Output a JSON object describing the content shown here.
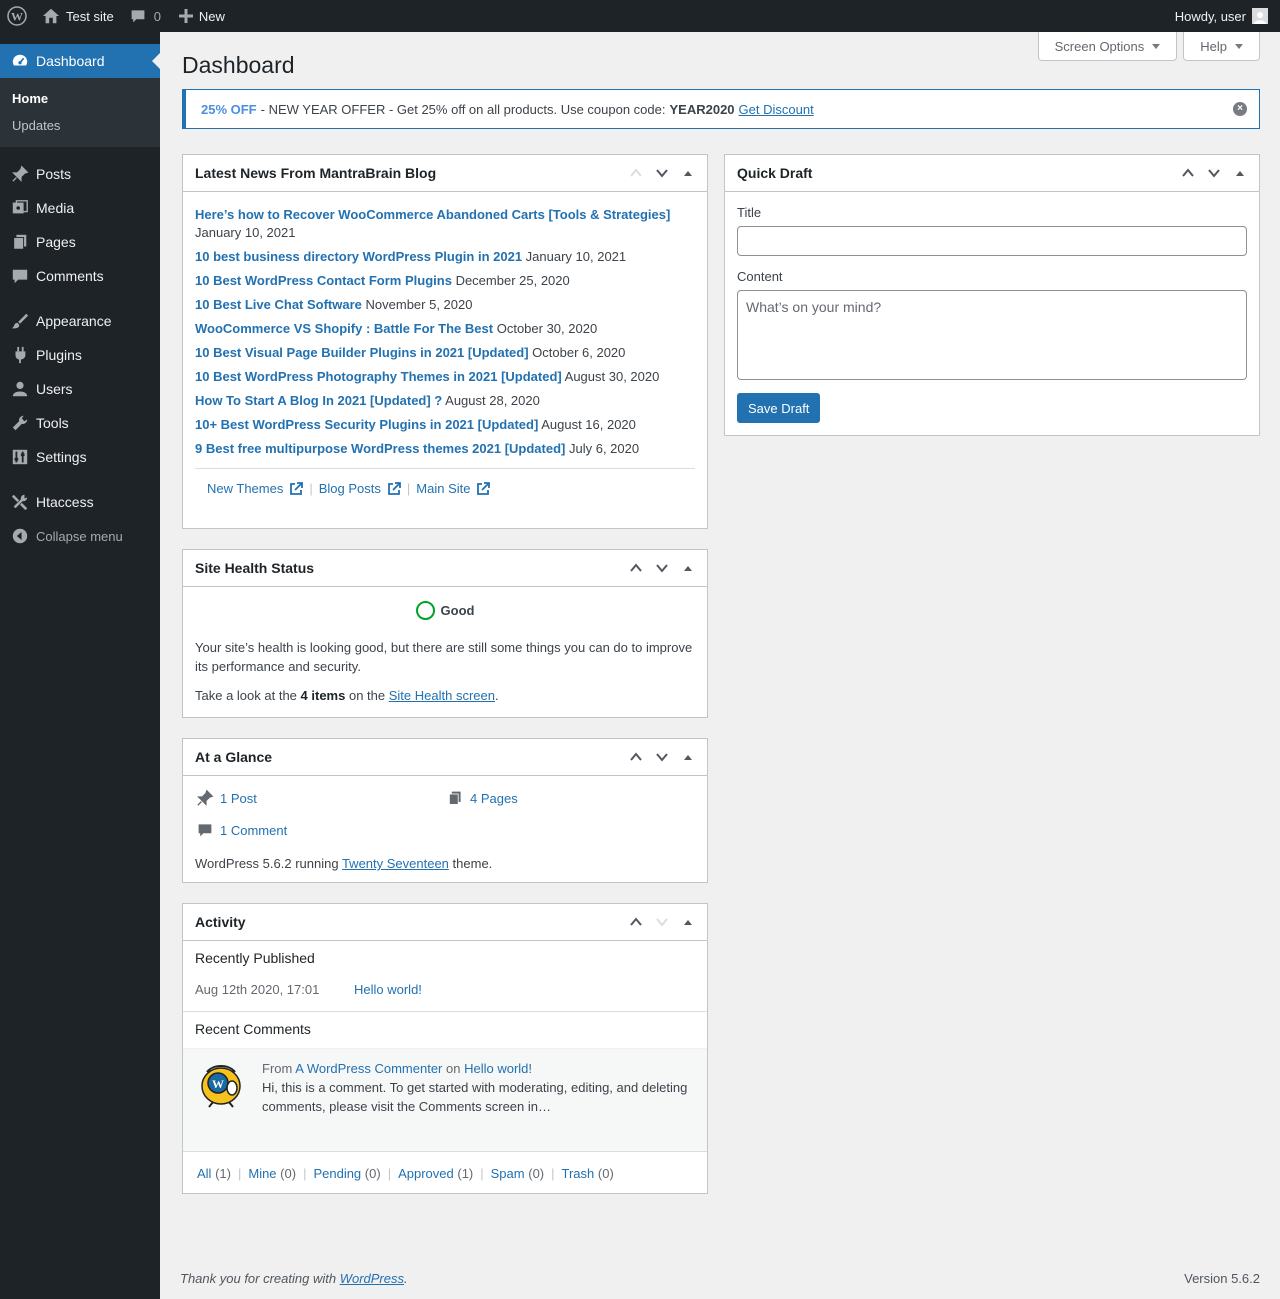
{
  "adminbar": {
    "site_name": "Test site",
    "comment_count": "0",
    "new_label": "New",
    "howdy": "Howdy, user"
  },
  "sidebar": {
    "current": "Dashboard",
    "submenu": [
      "Home",
      "Updates"
    ],
    "items": [
      {
        "label": "Posts",
        "icon": "pin-icon"
      },
      {
        "label": "Media",
        "icon": "media-icon"
      },
      {
        "label": "Pages",
        "icon": "pages-icon"
      },
      {
        "label": "Comments",
        "icon": "comments-icon"
      },
      {
        "label": "Appearance",
        "icon": "brush-icon"
      },
      {
        "label": "Plugins",
        "icon": "plugin-icon"
      },
      {
        "label": "Users",
        "icon": "user-icon"
      },
      {
        "label": "Tools",
        "icon": "wrench-icon"
      },
      {
        "label": "Settings",
        "icon": "settings-icon"
      },
      {
        "label": "Htaccess",
        "icon": "tools-icon"
      }
    ],
    "collapse": "Collapse menu"
  },
  "screen_meta": {
    "screen_options": "Screen Options",
    "help": "Help"
  },
  "page_title": "Dashboard",
  "notice": {
    "badge": "25% OFF",
    "text": "- NEW YEAR OFFER - Get 25% off on all products. Use coupon code:",
    "code": "YEAR2020",
    "link": "Get Discount"
  },
  "news": {
    "title": "Latest News From MantraBrain Blog",
    "items": [
      {
        "title": "Here’s how to Recover WooCommerce Abandoned Carts [Tools & Strategies]",
        "date": "January 10, 2021"
      },
      {
        "title": "10 best business directory WordPress Plugin in 2021",
        "date": "January 10, 2021"
      },
      {
        "title": "10 Best WordPress Contact Form Plugins",
        "date": "December 25, 2020"
      },
      {
        "title": "10 Best Live Chat Software",
        "date": "November 5, 2020"
      },
      {
        "title": "WooCommerce VS Shopify : Battle For The Best",
        "date": "October 30, 2020"
      },
      {
        "title": "10 Best Visual Page Builder Plugins in 2021 [Updated]",
        "date": "October 6, 2020"
      },
      {
        "title": "10 Best WordPress Photography Themes in 2021 [Updated]",
        "date": "August 30, 2020"
      },
      {
        "title": "How To Start A Blog In 2021 [Updated] ?",
        "date": "August 28, 2020"
      },
      {
        "title": "10+ Best WordPress Security Plugins in 2021 [Updated]",
        "date": "August 16, 2020"
      },
      {
        "title": "9 Best free multipurpose WordPress themes 2021 [Updated]",
        "date": "July 6, 2020"
      }
    ],
    "links": [
      "New Themes",
      "Blog Posts",
      "Main Site"
    ]
  },
  "health": {
    "title": "Site Health Status",
    "status": "Good",
    "desc": "Your site’s health is looking good, but there are still some things you can do to improve its performance and security.",
    "take_look": "Take a look at the",
    "items_count": "4 items",
    "on_the": "on the",
    "link": "Site Health screen",
    "period": "."
  },
  "glance": {
    "title": "At a Glance",
    "posts": "1 Post",
    "pages": "4 Pages",
    "comments": "1 Comment",
    "running": "WordPress 5.6.2 running",
    "theme": "Twenty Seventeen",
    "theme_suffix": "theme."
  },
  "activity": {
    "title": "Activity",
    "recently_published": "Recently Published",
    "pub_date": "Aug 12th 2020, 17:01",
    "pub_title": "Hello world!",
    "recent_comments": "Recent Comments",
    "comment_from": "From",
    "comment_author": "A WordPress Commenter",
    "comment_on": "on",
    "comment_post": "Hello world!",
    "comment_text": "Hi, this is a comment. To get started with moderating, editing, and deleting comments, please visit the Comments screen in…",
    "filters": [
      {
        "label": "All",
        "count": "(1)"
      },
      {
        "label": "Mine",
        "count": "(0)"
      },
      {
        "label": "Pending",
        "count": "(0)"
      },
      {
        "label": "Approved",
        "count": "(1)"
      },
      {
        "label": "Spam",
        "count": "(0)"
      },
      {
        "label": "Trash",
        "count": "(0)"
      }
    ]
  },
  "quick_draft": {
    "title": "Quick Draft",
    "title_label": "Title",
    "content_label": "Content",
    "content_placeholder": "What’s on your mind?",
    "save": "Save Draft"
  },
  "footer": {
    "thanks": "Thank you for creating with",
    "wp_link": "WordPress",
    "period": ".",
    "version": "Version 5.6.2"
  },
  "colors": {
    "accent": "#2271b1",
    "sidebar": "#1d2327",
    "good": "#00a32a"
  }
}
